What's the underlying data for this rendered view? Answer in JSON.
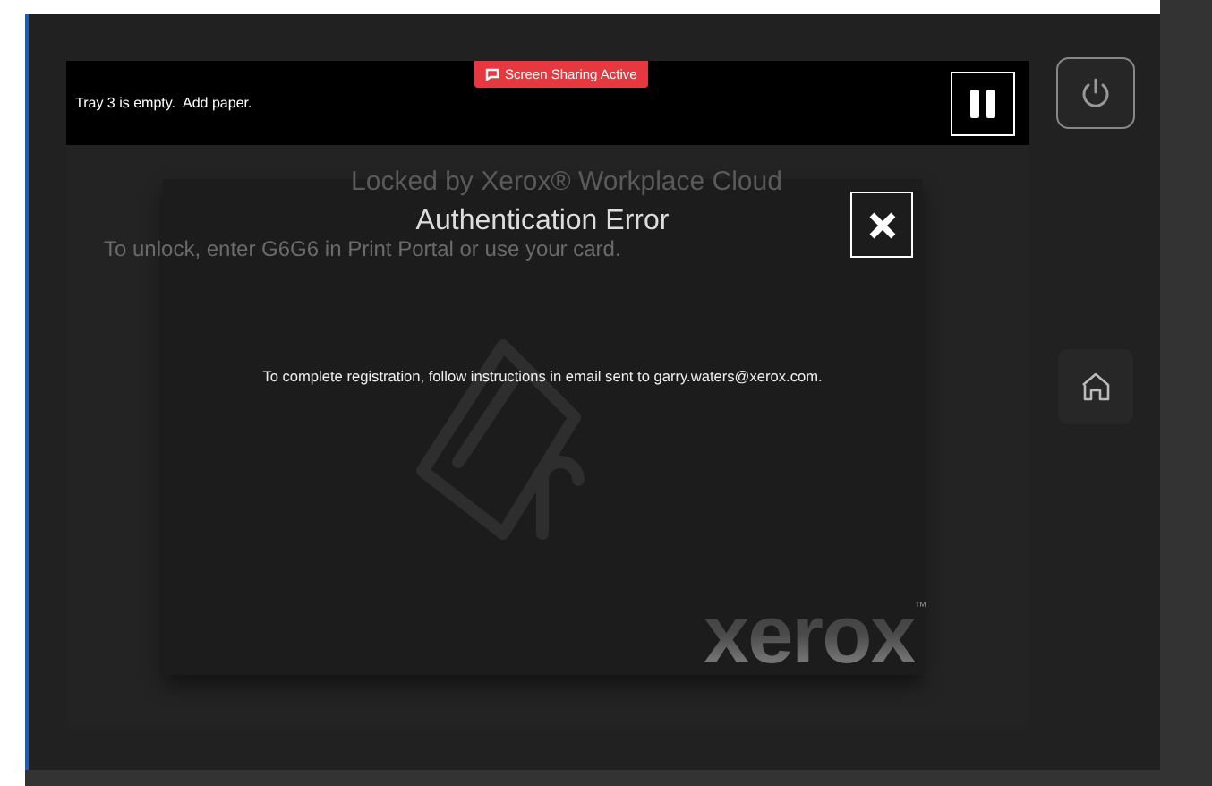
{
  "banner": {
    "message": "Tray 3 is empty.  Add paper.",
    "sharing_badge": "Screen Sharing Active"
  },
  "lock_screen": {
    "title": "Locked by Xerox® Workplace Cloud",
    "instruction": "To unlock, enter G6G6 in Print Portal or use your card."
  },
  "dialog": {
    "title": "Authentication Error",
    "message": "To complete registration, follow instructions in email sent to garry.waters@xerox.com."
  },
  "logo": {
    "text": "xerox",
    "mark": "™"
  }
}
